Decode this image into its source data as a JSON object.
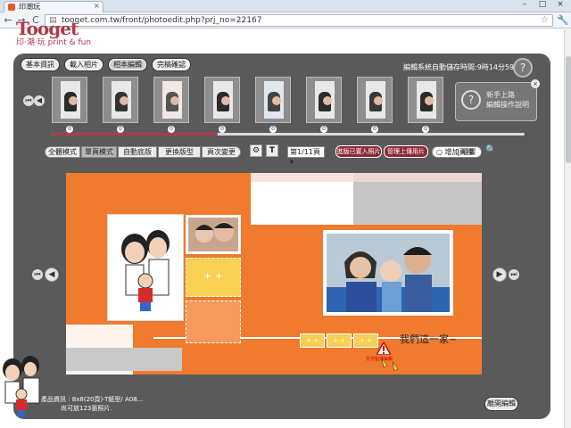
{
  "browser": {
    "tab_title": "印潮玩",
    "tab_close": "×",
    "url": "tooget.com.tw/front/photoedit.php?prj_no=22167",
    "back": "←",
    "forward": "→",
    "reload": "C",
    "star": "☆",
    "wrench": "🔧",
    "win_min": "–",
    "win_max": "□",
    "win_close": "×"
  },
  "logo": {
    "text": "Tooget",
    "sub": "印·潮·玩 print & fun"
  },
  "toolbar": {
    "buttons": [
      "基本資訊",
      "載入相片",
      "相本編輯",
      "完稿確認"
    ],
    "save_time": "編輯系統自動儲存時間:9時14分59秒",
    "help": "?"
  },
  "strip": {
    "prev": "◀",
    "numbers": [
      "0",
      "0",
      "0",
      "0",
      "0",
      "0",
      "0",
      "0"
    ],
    "progress": 0.35
  },
  "tooltip": {
    "q": "?",
    "line1": "新手上路",
    "line2": "編輯操作說明",
    "close": "×"
  },
  "toolbar2": {
    "modes": [
      "全體模式",
      "單頁模式",
      "自動底版",
      "更換版型",
      "頁次變更"
    ],
    "tool1": "⚙",
    "tool2": "T",
    "page_select": "第1/11頁 ▾",
    "red1": "進版已置入照片",
    "red2": "管理上傳用片",
    "radio": "增加頁裡",
    "tail": "| 隨響",
    "search": "🔍"
  },
  "canvas": {
    "slot_plus": "+ +",
    "yslots": [
      "+ +",
      "+ +",
      "+ +"
    ],
    "caption": "我們這一家~",
    "warn_text": "文字點選編輯"
  },
  "nav": {
    "left": "◀",
    "right": "▶"
  },
  "info": {
    "line1": "產品資訊 : 8x8(20頁)-T紙型/ A08...",
    "line2": "尚可放123張照片."
  },
  "leave": "離開編輯",
  "colors": {
    "accent": "#8c2b3a",
    "canvas_orange": "#f07a2e",
    "panel": "#5a5a5a"
  }
}
